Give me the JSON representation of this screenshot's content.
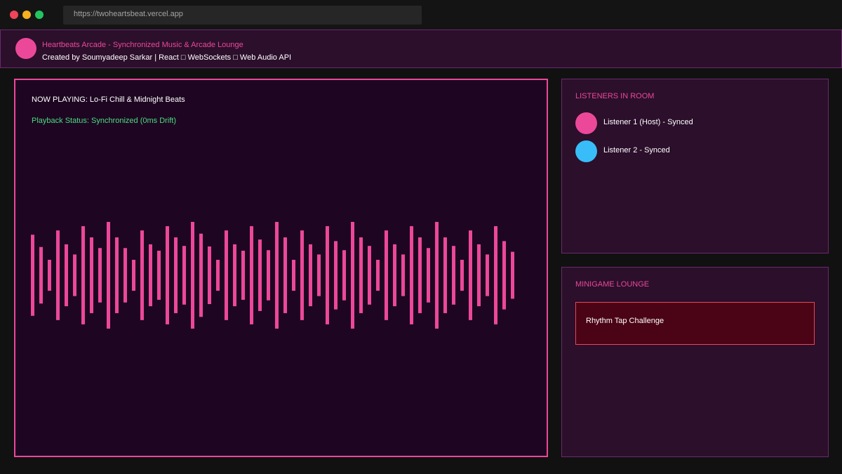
{
  "browser": {
    "url": "https://twoheartsbeat.vercel.app",
    "window_buttons": [
      "close",
      "minimize",
      "maximize"
    ]
  },
  "header": {
    "title": "Heartbeats Arcade - Synchronized Music & Arcade Lounge",
    "credit": "Created by Soumyadeep Sarkar | React □ WebSockets □ Web Audio API",
    "logo_color": "#ec4899"
  },
  "player": {
    "now_playing": "NOW PLAYING: Lo-Fi Chill & Midnight Beats",
    "status": "Playback Status: Synchronized (0ms Drift)",
    "visualizer": {
      "color": "#ec4899",
      "levels": [
        0.76,
        0.53,
        0.29,
        0.84,
        0.58,
        0.39,
        0.92,
        0.71,
        0.51,
        1.0,
        0.71,
        0.51,
        0.29,
        0.84,
        0.58,
        0.46,
        0.92,
        0.71,
        0.55,
        1.0,
        0.78,
        0.54,
        0.29,
        0.84,
        0.58,
        0.46,
        0.92,
        0.67,
        0.47,
        1.0,
        0.71,
        0.29,
        0.84,
        0.58,
        0.39,
        0.92,
        0.64,
        0.47,
        1.0,
        0.71,
        0.55,
        0.29,
        0.84,
        0.58,
        0.39,
        0.92,
        0.71,
        0.51,
        1.0,
        0.71,
        0.55,
        0.29,
        0.84,
        0.58,
        0.39,
        0.92,
        0.64,
        0.44
      ]
    }
  },
  "listeners": {
    "heading": "LISTENERS IN ROOM",
    "items": [
      {
        "label": "Listener 1 (Host) - Synced",
        "color": "#ec4899"
      },
      {
        "label": "Listener 2 - Synced",
        "color": "#38bdf8"
      }
    ]
  },
  "minigame": {
    "heading": "MINIGAME LOUNGE",
    "games": [
      {
        "label": "Rhythm Tap Challenge"
      }
    ]
  }
}
